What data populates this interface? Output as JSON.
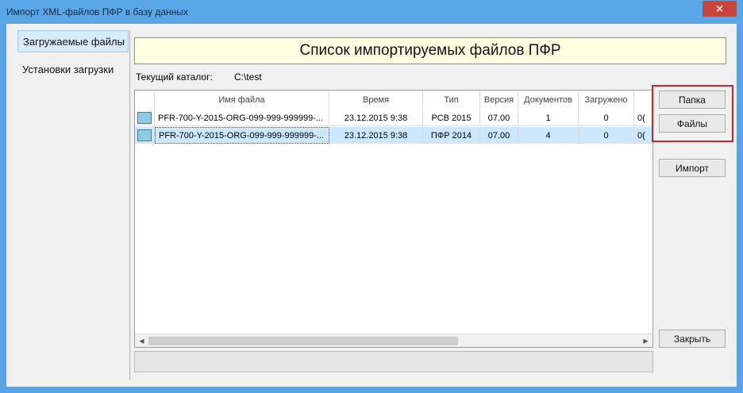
{
  "window": {
    "title": "Импорт XML-файлов ПФР в базу данных",
    "close_symbol": "✕"
  },
  "nav": {
    "items": [
      {
        "label": "Загружаемые файлы",
        "selected": true
      },
      {
        "label": "Установки загрузки",
        "selected": false
      }
    ]
  },
  "main": {
    "header": "Список импортируемых файлов ПФР",
    "dir_label": "Текущий каталог:",
    "dir_value": "C:\\test"
  },
  "grid": {
    "columns": [
      "",
      "Имя файла",
      "Время",
      "Тип",
      "Версия",
      "Документов",
      "Загружено",
      ""
    ],
    "rows": [
      {
        "name": "PFR-700-Y-2015-ORG-099-999-999999-...",
        "time": "23.12.2015 9:38",
        "type": "РСВ 2015",
        "version": "07.00",
        "docs": "1",
        "loaded": "0",
        "extra": "0(",
        "selected": false
      },
      {
        "name": "PFR-700-Y-2015-ORG-099-999-999999-...",
        "time": "23.12.2015 9:38",
        "type": "ПФР 2014",
        "version": "07.00",
        "docs": "4",
        "loaded": "0",
        "extra": "0(",
        "selected": true
      }
    ],
    "scroll_left": "◀",
    "scroll_right": "▶"
  },
  "buttons": {
    "folder": "Папка",
    "files": "Файлы",
    "import": "Импорт",
    "close": "Закрыть"
  },
  "colors": {
    "highlight": "#d0202a",
    "header_bg": "#ffffe1",
    "selected_row": "#cce8ff"
  }
}
